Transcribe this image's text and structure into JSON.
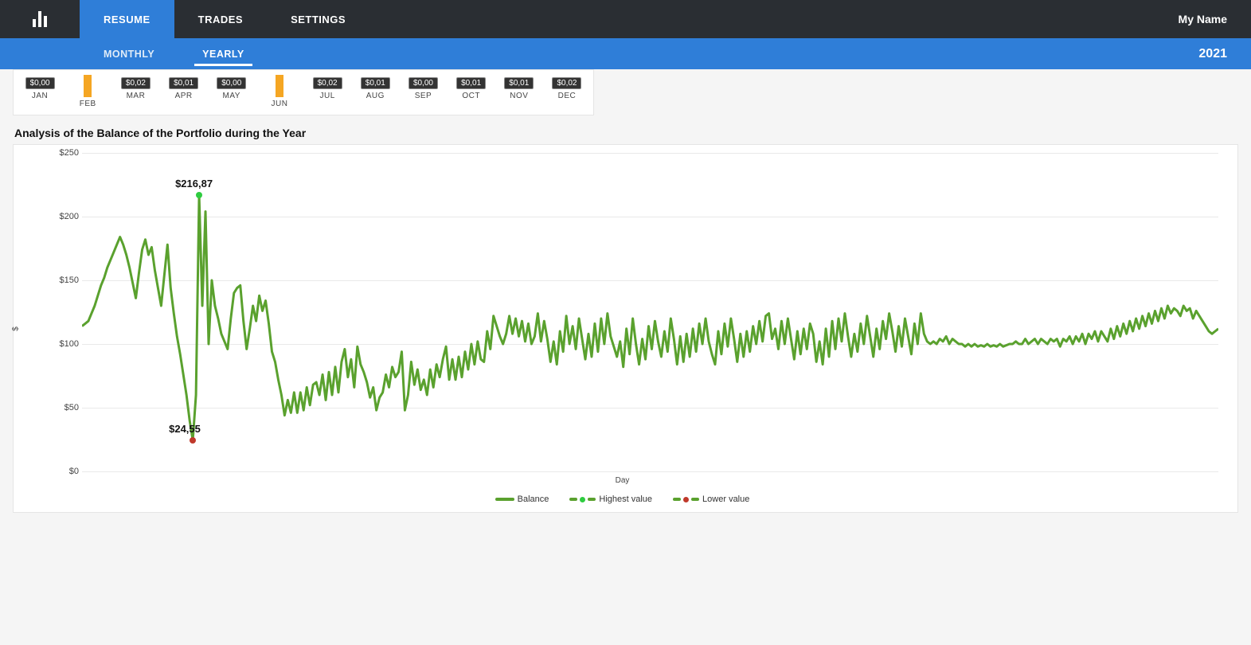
{
  "header": {
    "tabs": [
      {
        "id": "resume",
        "label": "RESUME",
        "active": true
      },
      {
        "id": "trades",
        "label": "TRADES",
        "active": false
      },
      {
        "id": "settings",
        "label": "SETTINGS",
        "active": false
      }
    ],
    "user_name": "My Name"
  },
  "subheader": {
    "tabs": [
      {
        "id": "monthly",
        "label": "MONTHLY",
        "active": false
      },
      {
        "id": "yearly",
        "label": "YEARLY",
        "active": true
      }
    ],
    "year": "2021"
  },
  "mini_chart": {
    "months": [
      {
        "label": "JAN",
        "badge": "$0,00",
        "bar": false
      },
      {
        "label": "FEB",
        "badge": "",
        "bar": true
      },
      {
        "label": "MAR",
        "badge": "$0,02",
        "bar": false
      },
      {
        "label": "APR",
        "badge": "$0,01",
        "bar": false
      },
      {
        "label": "MAY",
        "badge": "$0,00",
        "bar": false
      },
      {
        "label": "JUN",
        "badge": "",
        "bar": true
      },
      {
        "label": "JUL",
        "badge": "$0,02",
        "bar": false
      },
      {
        "label": "AUG",
        "badge": "$0,01",
        "bar": false
      },
      {
        "label": "SEP",
        "badge": "$0,00",
        "bar": false
      },
      {
        "label": "OCT",
        "badge": "$0,01",
        "bar": false
      },
      {
        "label": "NOV",
        "badge": "$0,01",
        "bar": false
      },
      {
        "label": "DEC",
        "badge": "$0,02",
        "bar": false
      }
    ]
  },
  "chart": {
    "title": "Analysis of the Balance of the Portfolio during the Year",
    "xlabel": "Day",
    "ylabel": "$",
    "highest_label": "$216,87",
    "lowest_label": "$24,55",
    "legend": {
      "balance": "Balance",
      "highest": "Highest value",
      "lowest": "Lower value"
    },
    "colors": {
      "line": "#5aa12e",
      "highest": "#2ecc40",
      "lowest": "#c0392b"
    }
  },
  "chart_data": {
    "type": "line",
    "title": "Analysis of the Balance of the Portfolio during the Year",
    "xlabel": "Day",
    "ylabel": "$",
    "ylim": [
      0,
      250
    ],
    "y_ticks": [
      0,
      50,
      100,
      150,
      200,
      250
    ],
    "y_tick_labels": [
      "$0",
      "$50",
      "$100",
      "$150",
      "$200",
      "$250"
    ],
    "highest": {
      "x": 37,
      "y": 216.87
    },
    "lowest": {
      "x": 35,
      "y": 24.55
    },
    "series": [
      {
        "name": "Balance",
        "color": "#5aa12e",
        "values": [
          114,
          116,
          118,
          124,
          130,
          138,
          146,
          152,
          160,
          166,
          172,
          178,
          184,
          178,
          170,
          160,
          148,
          136,
          156,
          174,
          182,
          170,
          176,
          158,
          144,
          130,
          154,
          178,
          144,
          124,
          106,
          92,
          76,
          60,
          40,
          24.55,
          60,
          216.87,
          130,
          204,
          100,
          150,
          130,
          120,
          108,
          102,
          96,
          120,
          140,
          144,
          146,
          118,
          96,
          112,
          130,
          118,
          138,
          126,
          134,
          116,
          94,
          86,
          72,
          60,
          44,
          56,
          46,
          62,
          46,
          62,
          48,
          66,
          52,
          68,
          70,
          60,
          76,
          56,
          78,
          60,
          82,
          62,
          86,
          96,
          74,
          88,
          66,
          98,
          84,
          78,
          70,
          58,
          66,
          48,
          58,
          62,
          76,
          66,
          82,
          74,
          78,
          94,
          48,
          60,
          86,
          68,
          80,
          64,
          72,
          60,
          80,
          66,
          84,
          74,
          88,
          98,
          72,
          88,
          72,
          90,
          74,
          94,
          80,
          100,
          84,
          102,
          88,
          86,
          110,
          96,
          122,
          114,
          106,
          100,
          108,
          122,
          108,
          120,
          106,
          118,
          102,
          116,
          100,
          106,
          124,
          102,
          118,
          104,
          86,
          102,
          84,
          110,
          94,
          122,
          100,
          114,
          96,
          120,
          104,
          88,
          108,
          90,
          116,
          94,
          120,
          100,
          124,
          106,
          98,
          90,
          102,
          82,
          112,
          92,
          120,
          100,
          84,
          104,
          88,
          114,
          96,
          118,
          102,
          90,
          110,
          94,
          120,
          104,
          84,
          106,
          86,
          108,
          90,
          112,
          94,
          116,
          100,
          120,
          102,
          92,
          84,
          110,
          92,
          116,
          98,
          120,
          104,
          86,
          108,
          90,
          110,
          94,
          114,
          100,
          118,
          102,
          122,
          124,
          104,
          112,
          96,
          118,
          100,
          120,
          104,
          88,
          110,
          92,
          112,
          96,
          116,
          108,
          86,
          102,
          84,
          112,
          90,
          118,
          96,
          120,
          102,
          124,
          106,
          90,
          108,
          94,
          116,
          100,
          122,
          106,
          90,
          112,
          96,
          118,
          104,
          124,
          110,
          94,
          114,
          98,
          120,
          106,
          92,
          116,
          100,
          124,
          108,
          102,
          100,
          102,
          100,
          104,
          102,
          106,
          100,
          104,
          102,
          100,
          100,
          98,
          100,
          98,
          100,
          98,
          99,
          98,
          100,
          98,
          99,
          98,
          100,
          98,
          99,
          100,
          100,
          102,
          100,
          100,
          104,
          100,
          102,
          104,
          100,
          104,
          102,
          100,
          104,
          102,
          104,
          98,
          104,
          102,
          106,
          100,
          106,
          102,
          108,
          100,
          108,
          104,
          110,
          102,
          110,
          106,
          102,
          112,
          104,
          114,
          106,
          116,
          108,
          118,
          110,
          120,
          112,
          122,
          114,
          124,
          116,
          126,
          118,
          128,
          120,
          130,
          124,
          128,
          126,
          122,
          130,
          126,
          128,
          120,
          126,
          122,
          118,
          114,
          110,
          108,
          110,
          112
        ]
      }
    ]
  }
}
